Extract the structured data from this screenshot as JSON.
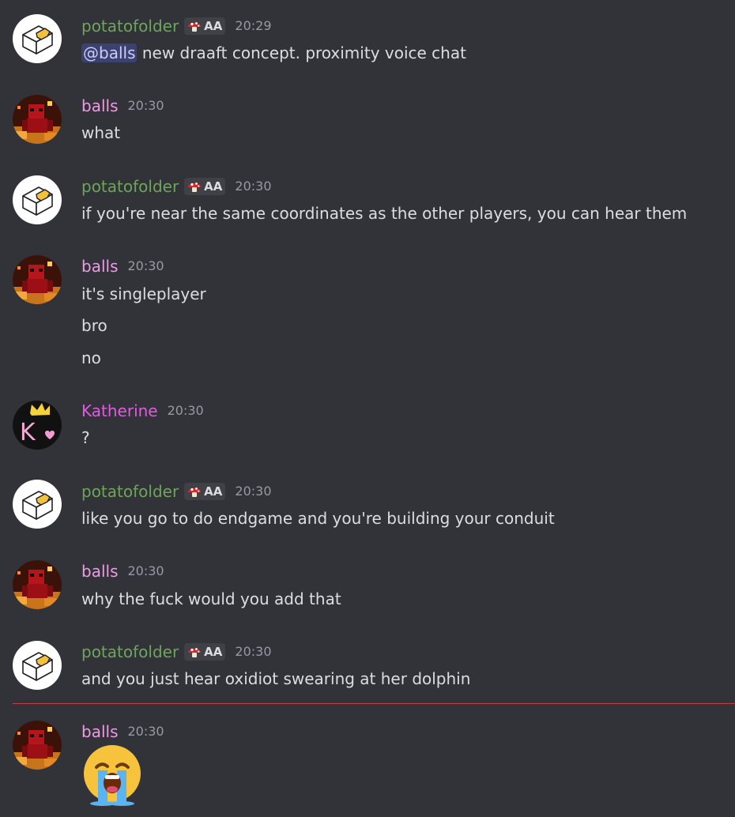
{
  "colors": {
    "background": "#313338",
    "potatofolder_name": "#6fa55b",
    "balls_name": "#f09ae6",
    "katherine_name": "#e15ae0",
    "new_messages_divider": "#c93c45"
  },
  "messages": [
    {
      "author": "potatofolder",
      "tag": "AA",
      "tag_icon": "mushroom-icon",
      "time": "20:29",
      "avatar_icon": "folder-cube-avatar",
      "mention": "@balls",
      "lines": [
        " new draaft concept. proximity voice chat"
      ]
    },
    {
      "author": "balls",
      "time": "20:30",
      "avatar_icon": "red-minecraft-character-avatar",
      "lines": [
        "what"
      ]
    },
    {
      "author": "potatofolder",
      "tag": "AA",
      "tag_icon": "mushroom-icon",
      "time": "20:30",
      "avatar_icon": "folder-cube-avatar",
      "lines": [
        "if you're near the same coordinates as the other players, you can hear them"
      ]
    },
    {
      "author": "balls",
      "time": "20:30",
      "avatar_icon": "red-minecraft-character-avatar",
      "lines": [
        "it's singleplayer",
        "bro",
        "no"
      ]
    },
    {
      "author": "Katherine",
      "time": "20:30",
      "avatar_icon": "k-crown-avatar",
      "avatar_letter": "K",
      "lines": [
        "?"
      ]
    },
    {
      "author": "potatofolder",
      "tag": "AA",
      "tag_icon": "mushroom-icon",
      "time": "20:30",
      "avatar_icon": "folder-cube-avatar",
      "lines": [
        "like you go to do endgame and you're building your conduit"
      ]
    },
    {
      "author": "balls",
      "time": "20:30",
      "avatar_icon": "red-minecraft-character-avatar",
      "lines": [
        "why the fuck would you add that"
      ]
    },
    {
      "author": "potatofolder",
      "tag": "AA",
      "tag_icon": "mushroom-icon",
      "time": "20:30",
      "avatar_icon": "folder-cube-avatar",
      "lines": [
        "and you just hear oxidiot swearing at her dolphin"
      ]
    },
    {
      "author": "balls",
      "time": "20:30",
      "avatar_icon": "red-minecraft-character-avatar",
      "emoji": "loudly-crying-face-emoji"
    }
  ]
}
